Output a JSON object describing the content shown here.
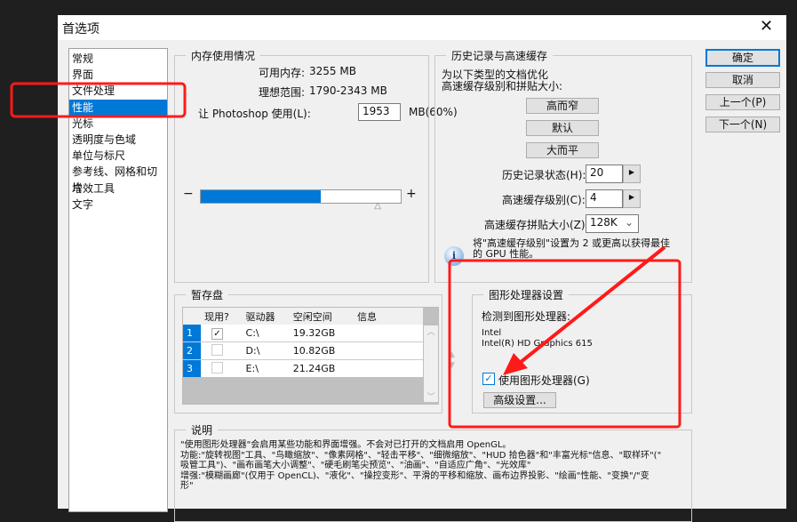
{
  "window": {
    "title": "首选项",
    "close_icon": "close-icon"
  },
  "sidebar": {
    "items": [
      {
        "label": "常规"
      },
      {
        "label": "界面"
      },
      {
        "label": "文件处理"
      },
      {
        "label": "性能"
      },
      {
        "label": "光标"
      },
      {
        "label": "透明度与色域"
      },
      {
        "label": "单位与标尺"
      },
      {
        "label": "参考线、网格和切片"
      },
      {
        "label": "增效工具"
      },
      {
        "label": "文字"
      }
    ],
    "selected": "性能"
  },
  "buttons": {
    "ok": "确定",
    "cancel": "取消",
    "prev": "上一个(P)",
    "next": "下一个(N)"
  },
  "memory": {
    "legend": "内存使用情况",
    "available_label": "可用内存:",
    "available": "3255 MB",
    "ideal_label": "理想范围:",
    "ideal": "1790-2343 MB",
    "use_label": "让 Photoshop 使用(L):",
    "use_value": "1953",
    "use_unit": "MB(60%)",
    "minus": "−",
    "plus": "+",
    "slider_percent": 60
  },
  "history": {
    "legend": "历史记录与高速缓存",
    "desc1": "为以下类型的文档优化",
    "desc2": "高速缓存级别和拼贴大小:",
    "preset1": "高而窄",
    "preset2": "默认",
    "preset3": "大而平",
    "states_label": "历史记录状态(H):",
    "states": "20",
    "cache_label": "高速缓存级别(C):",
    "cache": "4",
    "tile_label": "高速缓存拼贴大小(Z):",
    "tile": "128K",
    "info": "将\"高速缓存级别\"设置为 2 或更高以获得最佳的 GPU 性能。"
  },
  "scratch": {
    "legend": "暂存盘",
    "headers": [
      "",
      "现用?",
      "驱动器",
      "空闲空间",
      "信息"
    ],
    "rows": [
      {
        "n": "1",
        "active": true,
        "drive": "C:\\",
        "free": "19.32GB"
      },
      {
        "n": "2",
        "active": false,
        "drive": "D:\\",
        "free": "10.82GB"
      },
      {
        "n": "3",
        "active": false,
        "drive": "E:\\",
        "free": "21.24GB"
      }
    ]
  },
  "gpu": {
    "legend": "图形处理器设置",
    "detected": "检测到图形处理器:",
    "vendor": "Intel",
    "model": "Intel(R) HD Graphics 615",
    "use_label": "使用图形处理器(G)",
    "use_checked": true,
    "advanced": "高级设置..."
  },
  "desc": {
    "legend": "说明",
    "lines": [
      "\"使用图形处理器\"会启用某些功能和界面增强。不会对已打开的文档启用 OpenGL。",
      "功能:\"旋转视图\"工具、\"鸟瞰缩放\"、\"像素网格\"、\"轻击平移\"、\"细微缩放\"、\"HUD 拾色器\"和\"丰富光标\"信息、\"取样环\"(\"",
      "吸管工具\")、\"画布画笔大小调整\"、\"硬毛刷笔尖预览\"、\"油画\"、\"自适应广角\"、\"光效库\"",
      "增强:\"模糊画廊\"(仅用于 OpenCL)、\"液化\"、\"操控变形\"、平滑的平移和缩放、画布边界投影、\"绘画\"性能、\"变换\"/\"变",
      "形\""
    ]
  },
  "colors": {
    "accent": "#0078d7",
    "annotation": "#ff1a1a"
  }
}
